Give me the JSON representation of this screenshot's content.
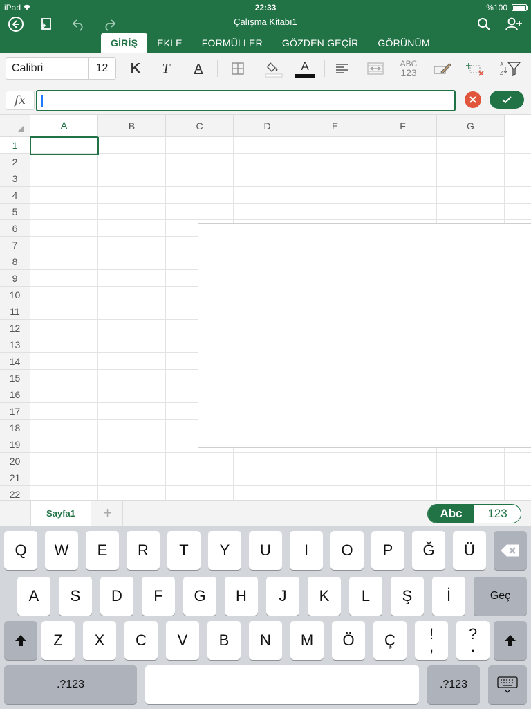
{
  "status": {
    "device": "iPad",
    "time": "22:33",
    "battery": "%100"
  },
  "title": "Çalışma Kitabı1",
  "ribbon_tabs": [
    {
      "label": "GİRİŞ",
      "active": true
    },
    {
      "label": "EKLE"
    },
    {
      "label": "FORMÜLLER"
    },
    {
      "label": "GÖZDEN GEÇİR"
    },
    {
      "label": "GÖRÜNÜM"
    }
  ],
  "toolbar": {
    "font": "Calibri",
    "size": "12",
    "bold": "K",
    "italic": "T",
    "underline": "A",
    "font_color": "A",
    "number_format_top": "ABC",
    "number_format_bottom": "123"
  },
  "formula": {
    "fx_label": "fx",
    "value": ""
  },
  "columns": [
    "A",
    "B",
    "C",
    "D",
    "E",
    "F",
    "G"
  ],
  "rows": [
    "1",
    "2",
    "3",
    "4",
    "5",
    "6",
    "7",
    "8",
    "9",
    "10",
    "11",
    "12",
    "13",
    "14",
    "15",
    "16",
    "17",
    "18",
    "19",
    "20",
    "21",
    "22"
  ],
  "sheet": {
    "tab": "Sayfa1",
    "add": "+"
  },
  "input_toggle": {
    "abc": "Abc",
    "num": "123"
  },
  "keyboard": {
    "row1": [
      "Q",
      "W",
      "E",
      "R",
      "T",
      "Y",
      "U",
      "I",
      "O",
      "P",
      "Ğ",
      "Ü"
    ],
    "row2": [
      "A",
      "S",
      "D",
      "F",
      "G",
      "H",
      "J",
      "K",
      "L",
      "Ş",
      "İ"
    ],
    "go": "Geç",
    "row3": [
      "Z",
      "X",
      "C",
      "V",
      "B",
      "N",
      "M",
      "Ö",
      "Ç"
    ],
    "punct1_top": "!",
    "punct1_bottom": ",",
    "punct2_top": "?",
    "punct2_bottom": ".",
    "numbers": ".?123"
  },
  "colors": {
    "accent": "#217346",
    "cancel": "#e0553c"
  }
}
